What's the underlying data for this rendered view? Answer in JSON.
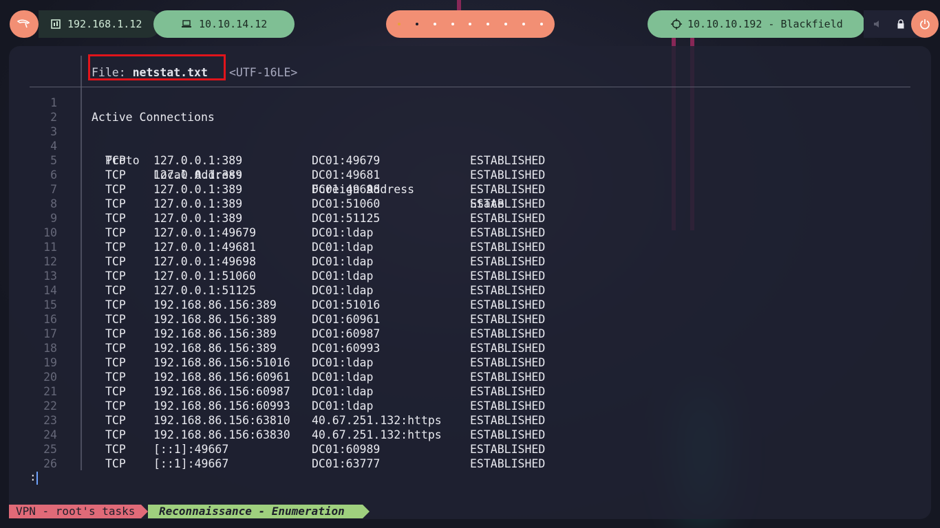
{
  "topbar": {
    "local_ip": "192.168.1.12",
    "vpn_ip": "10.10.14.12",
    "target": "10.10.10.192 - Blackfield",
    "workspace_count": 9,
    "active_workspace": 2
  },
  "file": {
    "label": "File:",
    "name": "netstat.txt",
    "encoding": "<UTF-16LE>"
  },
  "columns": {
    "proto": "Proto",
    "local": "Local Address",
    "foreign": "Foreign Address",
    "state": "State"
  },
  "title_line": "Active Connections",
  "connections": [
    [
      "TCP",
      "127.0.0.1:389",
      "DC01:49679",
      "ESTABLISHED"
    ],
    [
      "TCP",
      "127.0.0.1:389",
      "DC01:49681",
      "ESTABLISHED"
    ],
    [
      "TCP",
      "127.0.0.1:389",
      "DC01:49698",
      "ESTABLISHED"
    ],
    [
      "TCP",
      "127.0.0.1:389",
      "DC01:51060",
      "ESTABLISHED"
    ],
    [
      "TCP",
      "127.0.0.1:389",
      "DC01:51125",
      "ESTABLISHED"
    ],
    [
      "TCP",
      "127.0.0.1:49679",
      "DC01:ldap",
      "ESTABLISHED"
    ],
    [
      "TCP",
      "127.0.0.1:49681",
      "DC01:ldap",
      "ESTABLISHED"
    ],
    [
      "TCP",
      "127.0.0.1:49698",
      "DC01:ldap",
      "ESTABLISHED"
    ],
    [
      "TCP",
      "127.0.0.1:51060",
      "DC01:ldap",
      "ESTABLISHED"
    ],
    [
      "TCP",
      "127.0.0.1:51125",
      "DC01:ldap",
      "ESTABLISHED"
    ],
    [
      "TCP",
      "192.168.86.156:389",
      "DC01:51016",
      "ESTABLISHED"
    ],
    [
      "TCP",
      "192.168.86.156:389",
      "DC01:60961",
      "ESTABLISHED"
    ],
    [
      "TCP",
      "192.168.86.156:389",
      "DC01:60987",
      "ESTABLISHED"
    ],
    [
      "TCP",
      "192.168.86.156:389",
      "DC01:60993",
      "ESTABLISHED"
    ],
    [
      "TCP",
      "192.168.86.156:51016",
      "DC01:ldap",
      "ESTABLISHED"
    ],
    [
      "TCP",
      "192.168.86.156:60961",
      "DC01:ldap",
      "ESTABLISHED"
    ],
    [
      "TCP",
      "192.168.86.156:60987",
      "DC01:ldap",
      "ESTABLISHED"
    ],
    [
      "TCP",
      "192.168.86.156:60993",
      "DC01:ldap",
      "ESTABLISHED"
    ],
    [
      "TCP",
      "192.168.86.156:63810",
      "40.67.251.132:https",
      "ESTABLISHED"
    ],
    [
      "TCP",
      "192.168.86.156:63830",
      "40.67.251.132:https",
      "ESTABLISHED"
    ],
    [
      "TCP",
      "[::1]:49667",
      "DC01:60989",
      "ESTABLISHED"
    ],
    [
      "TCP",
      "[::1]:49667",
      "DC01:63777",
      "ESTABLISHED"
    ]
  ],
  "prompt": ":",
  "statusbar": {
    "session": "VPN - root's tasks",
    "window": "Reconnaissance - Enumeration"
  }
}
